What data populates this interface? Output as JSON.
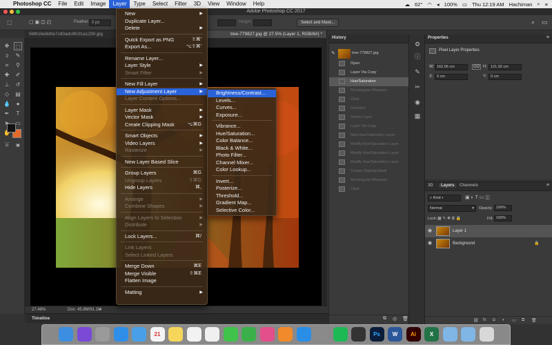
{
  "menubar": {
    "apple": "",
    "app": "Photoshop CC",
    "items": [
      "File",
      "Edit",
      "Image",
      "Layer",
      "Type",
      "Select",
      "Filter",
      "3D",
      "View",
      "Window",
      "Help"
    ],
    "active_index": 3,
    "status": {
      "temp": "62°",
      "battery": "100%",
      "clock": "Thu 12:19 AM",
      "user": "Hachiman"
    }
  },
  "window_title": "Adobe Photoshop CC 2017",
  "options": {
    "feather_label": "Feather:",
    "feather_value": "0 px",
    "height_label": "Height:",
    "select_mask": "Select and Mask..."
  },
  "doc_tabs": [
    {
      "label": "5bf618e8d0e7c80adc8fc91a1290.jpg"
    },
    {
      "label": "tree-779827.jpg @ 27.5% (Layer 1, RGB/8#) *"
    }
  ],
  "status": {
    "zoom": "27.48%",
    "doc": "Doc: 45.8M/91.1M"
  },
  "timeline_label": "Timeline",
  "history": {
    "tab": "History",
    "snapshot": "tree-779827.jpg",
    "rows": [
      {
        "label": "Open",
        "state": "normal"
      },
      {
        "label": "Layer Via Copy",
        "state": "normal"
      },
      {
        "label": "Hue/Saturation",
        "state": "selected"
      },
      {
        "label": "Rectangular Marquee",
        "state": "grey"
      },
      {
        "label": "Clear",
        "state": "grey"
      },
      {
        "label": "Deselect",
        "state": "grey"
      },
      {
        "label": "Delete Layer",
        "state": "grey"
      },
      {
        "label": "Layer Via Copy",
        "state": "grey"
      },
      {
        "label": "New Hue/Saturation Layer",
        "state": "grey"
      },
      {
        "label": "Modify Hue/Saturation Layer",
        "state": "grey"
      },
      {
        "label": "Modify Hue/Saturation Layer",
        "state": "grey"
      },
      {
        "label": "Modify Hue/Saturation Layer",
        "state": "grey"
      },
      {
        "label": "Create Clipping Mask",
        "state": "grey"
      },
      {
        "label": "Rectangular Marquee",
        "state": "grey"
      },
      {
        "label": "Clear",
        "state": "grey"
      }
    ]
  },
  "properties": {
    "tab": "Properties",
    "subtitle": "Pixel Layer Properties",
    "w_label": "W:",
    "w": "162.56 cm",
    "h_label": "H:",
    "h": "121.92 cm",
    "x_label": "X:",
    "x": "0 cm",
    "y_label": "Y:",
    "y": "0 cm",
    "link_glyph": "GO"
  },
  "layers": {
    "tabs": [
      "3D",
      "Layers",
      "Channels"
    ],
    "kind": "Kind",
    "blend": "Normal",
    "opacity_label": "Opacity:",
    "opacity": "100%",
    "lock_label": "Lock:",
    "fill_label": "Fill:",
    "fill": "100%",
    "rows": [
      {
        "name": "Layer 1",
        "selected": true
      },
      {
        "name": "Background",
        "selected": false
      }
    ]
  },
  "menu": {
    "items": [
      {
        "label": "New",
        "shortcut": "",
        "arrow": true,
        "disabled": false
      },
      {
        "label": "Duplicate Layer...",
        "shortcut": "",
        "arrow": false,
        "disabled": false
      },
      {
        "label": "Delete",
        "shortcut": "",
        "arrow": true,
        "disabled": false
      },
      {
        "sep": true
      },
      {
        "label": "Quick Export as PNG",
        "shortcut": "⇧⌘'",
        "arrow": false,
        "disabled": false
      },
      {
        "label": "Export As...",
        "shortcut": "⌥⇧⌘'",
        "arrow": false,
        "disabled": false
      },
      {
        "sep": true
      },
      {
        "label": "Rename Layer...",
        "shortcut": "",
        "arrow": false,
        "disabled": false
      },
      {
        "label": "Layer Style",
        "shortcut": "",
        "arrow": true,
        "disabled": false
      },
      {
        "label": "Smart Filter",
        "shortcut": "",
        "arrow": true,
        "disabled": true
      },
      {
        "sep": true
      },
      {
        "label": "New Fill Layer",
        "shortcut": "",
        "arrow": true,
        "disabled": false
      },
      {
        "label": "New Adjustment Layer",
        "shortcut": "",
        "arrow": true,
        "disabled": false,
        "highlight": true
      },
      {
        "label": "Layer Content Options...",
        "shortcut": "",
        "arrow": false,
        "disabled": true
      },
      {
        "sep": true
      },
      {
        "label": "Layer Mask",
        "shortcut": "",
        "arrow": true,
        "disabled": false
      },
      {
        "label": "Vector Mask",
        "shortcut": "",
        "arrow": true,
        "disabled": false
      },
      {
        "label": "Create Clipping Mask",
        "shortcut": "⌥⌘G",
        "arrow": false,
        "disabled": false
      },
      {
        "sep": true
      },
      {
        "label": "Smart Objects",
        "shortcut": "",
        "arrow": true,
        "disabled": false
      },
      {
        "label": "Video Layers",
        "shortcut": "",
        "arrow": true,
        "disabled": false
      },
      {
        "label": "Rasterize",
        "shortcut": "",
        "arrow": true,
        "disabled": true
      },
      {
        "sep": true
      },
      {
        "label": "New Layer Based Slice",
        "shortcut": "",
        "arrow": false,
        "disabled": false
      },
      {
        "sep": true
      },
      {
        "label": "Group Layers",
        "shortcut": "⌘G",
        "arrow": false,
        "disabled": false
      },
      {
        "label": "Ungroup Layers",
        "shortcut": "⇧⌘G",
        "arrow": false,
        "disabled": true
      },
      {
        "label": "Hide Layers",
        "shortcut": "⌘,",
        "arrow": false,
        "disabled": false
      },
      {
        "sep": true
      },
      {
        "label": "Arrange",
        "shortcut": "",
        "arrow": true,
        "disabled": true
      },
      {
        "label": "Combine Shapes",
        "shortcut": "",
        "arrow": true,
        "disabled": true
      },
      {
        "sep": true
      },
      {
        "label": "Align Layers to Selection",
        "shortcut": "",
        "arrow": true,
        "disabled": true
      },
      {
        "label": "Distribute",
        "shortcut": "",
        "arrow": true,
        "disabled": true
      },
      {
        "sep": true
      },
      {
        "label": "Lock Layers...",
        "shortcut": "⌘/",
        "arrow": false,
        "disabled": false
      },
      {
        "sep": true
      },
      {
        "label": "Link Layers",
        "shortcut": "",
        "arrow": false,
        "disabled": true
      },
      {
        "label": "Select Linked Layers",
        "shortcut": "",
        "arrow": false,
        "disabled": true
      },
      {
        "sep": true
      },
      {
        "label": "Merge Down",
        "shortcut": "⌘E",
        "arrow": false,
        "disabled": false
      },
      {
        "label": "Merge Visible",
        "shortcut": "⇧⌘E",
        "arrow": false,
        "disabled": false
      },
      {
        "label": "Flatten Image",
        "shortcut": "",
        "arrow": false,
        "disabled": false
      },
      {
        "sep": true
      },
      {
        "label": "Matting",
        "shortcut": "",
        "arrow": true,
        "disabled": false
      }
    ]
  },
  "submenu": {
    "items": [
      {
        "label": "Brightness/Contrast...",
        "highlight": true
      },
      {
        "label": "Levels..."
      },
      {
        "label": "Curves..."
      },
      {
        "label": "Exposure..."
      },
      {
        "sep": true
      },
      {
        "label": "Vibrance..."
      },
      {
        "label": "Hue/Saturation..."
      },
      {
        "label": "Color Balance..."
      },
      {
        "label": "Black & White..."
      },
      {
        "label": "Photo Filter..."
      },
      {
        "label": "Channel Mixer..."
      },
      {
        "label": "Color Lookup..."
      },
      {
        "sep": true
      },
      {
        "label": "Invert..."
      },
      {
        "label": "Posterize..."
      },
      {
        "label": "Threshold..."
      },
      {
        "label": "Gradient Map..."
      },
      {
        "label": "Selective Color..."
      }
    ]
  },
  "dock": [
    {
      "name": "finder-icon",
      "color": "#3d8ee0"
    },
    {
      "name": "siri-icon",
      "color": "#7a4ad6"
    },
    {
      "name": "launchpad-icon",
      "color": "#9a9a9a"
    },
    {
      "name": "safari-icon",
      "color": "#2f8fe8"
    },
    {
      "name": "mail-icon",
      "color": "#4aa0e8"
    },
    {
      "name": "calendar-icon",
      "color": "#f4f4f4",
      "text": "21",
      "textColor": "#d33"
    },
    {
      "name": "notes-icon",
      "color": "#f6d65a"
    },
    {
      "name": "reminders-icon",
      "color": "#f2f2f2"
    },
    {
      "name": "photos-icon",
      "color": "#f0f0f0"
    },
    {
      "name": "messages-icon",
      "color": "#3fc34a"
    },
    {
      "name": "facetime-icon",
      "color": "#3bb04a"
    },
    {
      "name": "itunes-icon",
      "color": "#e24f8a"
    },
    {
      "name": "ibooks-icon",
      "color": "#f08a2a"
    },
    {
      "name": "appstore-icon",
      "color": "#2a8de6"
    },
    {
      "name": "preferences-icon",
      "color": "#8a8a8a"
    },
    {
      "name": "spotify-icon",
      "color": "#1db954"
    },
    {
      "name": "terminal-icon",
      "color": "#333"
    },
    {
      "name": "photoshop-icon",
      "color": "#0b1d3a",
      "text": "Ps",
      "textColor": "#31a8ff"
    },
    {
      "name": "word-icon",
      "color": "#2b579a",
      "text": "W",
      "textColor": "#fff"
    },
    {
      "name": "illustrator-icon",
      "color": "#330000",
      "text": "Ai",
      "textColor": "#ff9a00"
    },
    {
      "name": "excel-icon",
      "color": "#217346",
      "text": "X",
      "textColor": "#fff"
    },
    {
      "name": "folder-icon",
      "color": "#7fb6e6"
    },
    {
      "name": "folder2-icon",
      "color": "#7fb6e6"
    },
    {
      "name": "trash-icon",
      "color": "#d8d8d8"
    }
  ]
}
